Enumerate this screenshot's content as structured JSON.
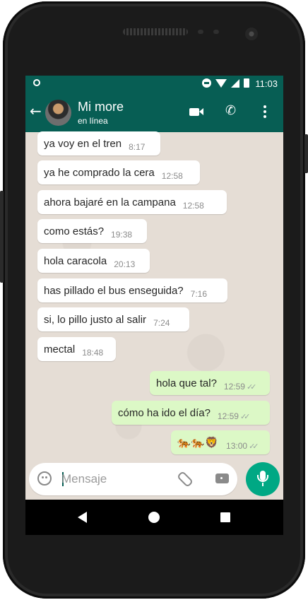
{
  "status_bar": {
    "time": "11:03"
  },
  "header": {
    "contact_name": "Mi more",
    "status": "en línea"
  },
  "messages": [
    {
      "text": "ya voy en el tren",
      "time": "8:17",
      "dir": "in"
    },
    {
      "text": "ya he comprado la cera",
      "time": "12:58",
      "dir": "in"
    },
    {
      "text": "ahora bajaré en la campana",
      "time": "12:58",
      "dir": "in"
    },
    {
      "text": "como estás?",
      "time": "19:38",
      "dir": "in"
    },
    {
      "text": "hola caracola",
      "time": "20:13",
      "dir": "in"
    },
    {
      "text": "has pillado el bus enseguida?",
      "time": "7:16",
      "dir": "in"
    },
    {
      "text": "si, lo pillo justo al salir",
      "time": "7:24",
      "dir": "in"
    },
    {
      "text": "mectal",
      "time": "18:48",
      "dir": "in"
    },
    {
      "text": "hola que tal?",
      "time": "12:59",
      "dir": "out",
      "ticks": "✓✓"
    },
    {
      "text": "cómo ha ido el día?",
      "time": "12:59",
      "dir": "out",
      "ticks": "✓✓"
    },
    {
      "text": "🐅🐅🦁",
      "time": "13:00",
      "dir": "out",
      "ticks": "✓✓"
    }
  ],
  "composer": {
    "placeholder": "Mensaje"
  },
  "icons": {
    "back": "arrow-left-icon",
    "video": "videocam-icon",
    "call": "phone-icon",
    "menu": "more-vert-icon",
    "emoji": "emoji-icon",
    "attach": "paperclip-icon",
    "camera": "camera-icon",
    "mic": "mic-icon"
  },
  "colors": {
    "primary": "#075e54",
    "outgoing_bubble": "#dcf8c6",
    "incoming_bubble": "#ffffff",
    "fab": "#00a884",
    "chat_bg": "#e5ddd5"
  }
}
